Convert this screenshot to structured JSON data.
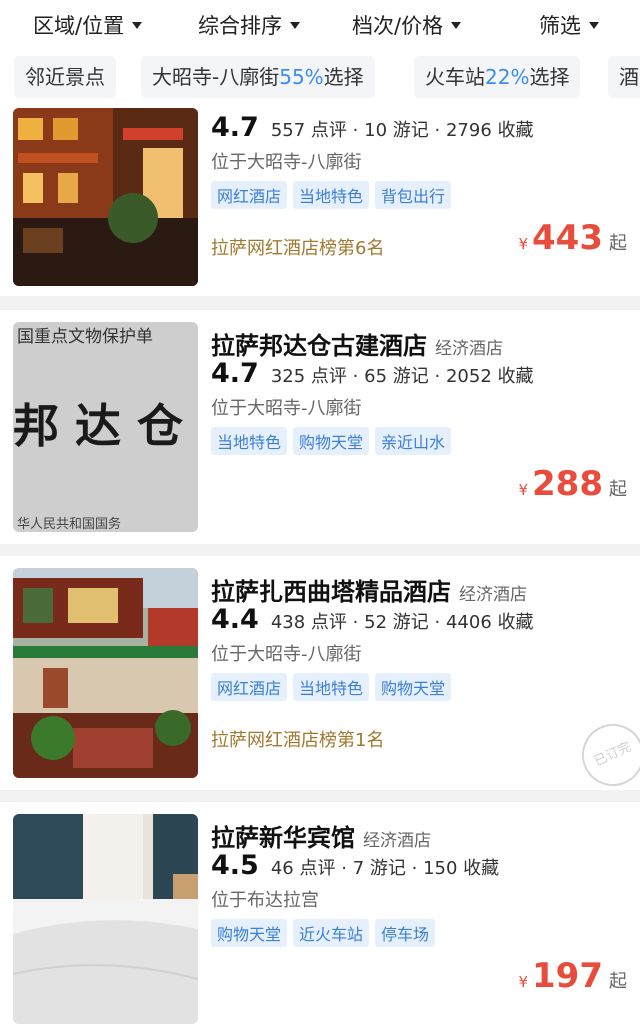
{
  "filters": [
    "区域/位置",
    "综合排序",
    "档次/价格",
    "筛选"
  ],
  "chips": [
    {
      "text": "邻近景点",
      "pct": "",
      "suffix": ""
    },
    {
      "text": "大昭寺-八廓街",
      "pct": "55%",
      "suffix": "选择"
    },
    {
      "text": "火车站",
      "pct": "22%",
      "suffix": "选择"
    },
    {
      "text": "酒",
      "pct": "",
      "suffix": ""
    }
  ],
  "hotels": [
    {
      "name": "",
      "category": "",
      "score": "4.7",
      "reviews": "557 点评",
      "notes": "10 游记",
      "favs": "2796 收藏",
      "location": "位于大昭寺-八廓街",
      "tags": [
        "网红酒店",
        "当地特色",
        "背包出行"
      ],
      "rank": "拉萨网红酒店榜第6名",
      "price": "443"
    },
    {
      "name": "拉萨邦达仓古建酒店",
      "category": "经济酒店",
      "score": "4.7",
      "reviews": "325 点评",
      "notes": "65 游记",
      "favs": "2052 收藏",
      "location": "位于大昭寺-八廓街",
      "tags": [
        "当地特色",
        "购物天堂",
        "亲近山水"
      ],
      "rank": "",
      "price": "288",
      "image_text": "国重点文物保护单",
      "image_big": "邦 达 仓",
      "image_footer": "华人民共和国国务"
    },
    {
      "name": "拉萨扎西曲塔精品酒店",
      "category": "经济酒店",
      "score": "4.4",
      "reviews": "438 点评",
      "notes": "52 游记",
      "favs": "4406 收藏",
      "location": "位于大昭寺-八廓街",
      "tags": [
        "网红酒店",
        "当地特色",
        "购物天堂"
      ],
      "rank": "拉萨网红酒店榜第1名",
      "price": "",
      "stamp": "已订完"
    },
    {
      "name": "拉萨新华宾馆",
      "category": "经济酒店",
      "score": "4.5",
      "reviews": "46 点评",
      "notes": "7 游记",
      "favs": "150 收藏",
      "location": "位于布达拉宫",
      "tags": [
        "购物天堂",
        "近火车站",
        "停车场"
      ],
      "rank": "",
      "price": "197"
    }
  ],
  "labels": {
    "currency": "¥",
    "from": "起",
    "dot": "·"
  }
}
